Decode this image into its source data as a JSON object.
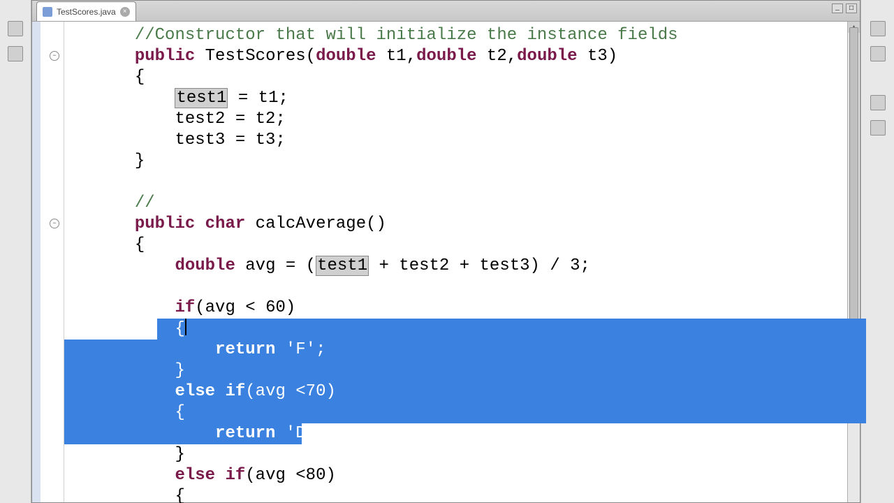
{
  "tab": {
    "filename": "TestScores.java",
    "close_glyph": "×"
  },
  "window": {
    "min_glyph": "_",
    "max_glyph": "□"
  },
  "gutter": {
    "fold1_glyph": "−",
    "fold2_glyph": "−"
  },
  "scrollbar": {
    "up_glyph": "▴"
  },
  "code": {
    "indent1": "       ",
    "indent2": "           ",
    "indent3": "               ",
    "l1_comment": "//Constructor that will initialize the instance fields",
    "l2_public": "public",
    "l2_name": " TestScores(",
    "l2_double1": "double",
    "l2_p1": " t1,",
    "l2_double2": "double",
    "l2_p2": " t2,",
    "l2_double3": "double",
    "l2_p3": " t3)",
    "l3_brace": "{",
    "l4_test1": "test1",
    "l4_rest": " = t1;",
    "l5": "test2 = t2;",
    "l6": "test3 = t3;",
    "l7_brace": "}",
    "l8": "",
    "l9_comment": "//",
    "l10_public": "public",
    "l10_char": "char",
    "l10_name": " calcAverage()",
    "l11_brace": "{",
    "l12_double": "double",
    "l12_a": " avg = (",
    "l12_test1": "test1",
    "l12_b": " + test2 + test3) / 3;",
    "l13": "",
    "l14_if": "if",
    "l14_cond": "(avg < 60)",
    "l15_brace": "{",
    "l16_return": "return",
    "l16_val": " 'F';",
    "l17_brace": "}",
    "l18_else": "else",
    "l18_if": "if",
    "l18_cond": "(avg <70)",
    "l19_brace": "{",
    "l20_return": "return",
    "l20_val": " 'D';",
    "l21_brace": "}",
    "l22_else": "else",
    "l22_if": "if",
    "l22_cond": "(avg <80)",
    "l23_brace": "{"
  }
}
